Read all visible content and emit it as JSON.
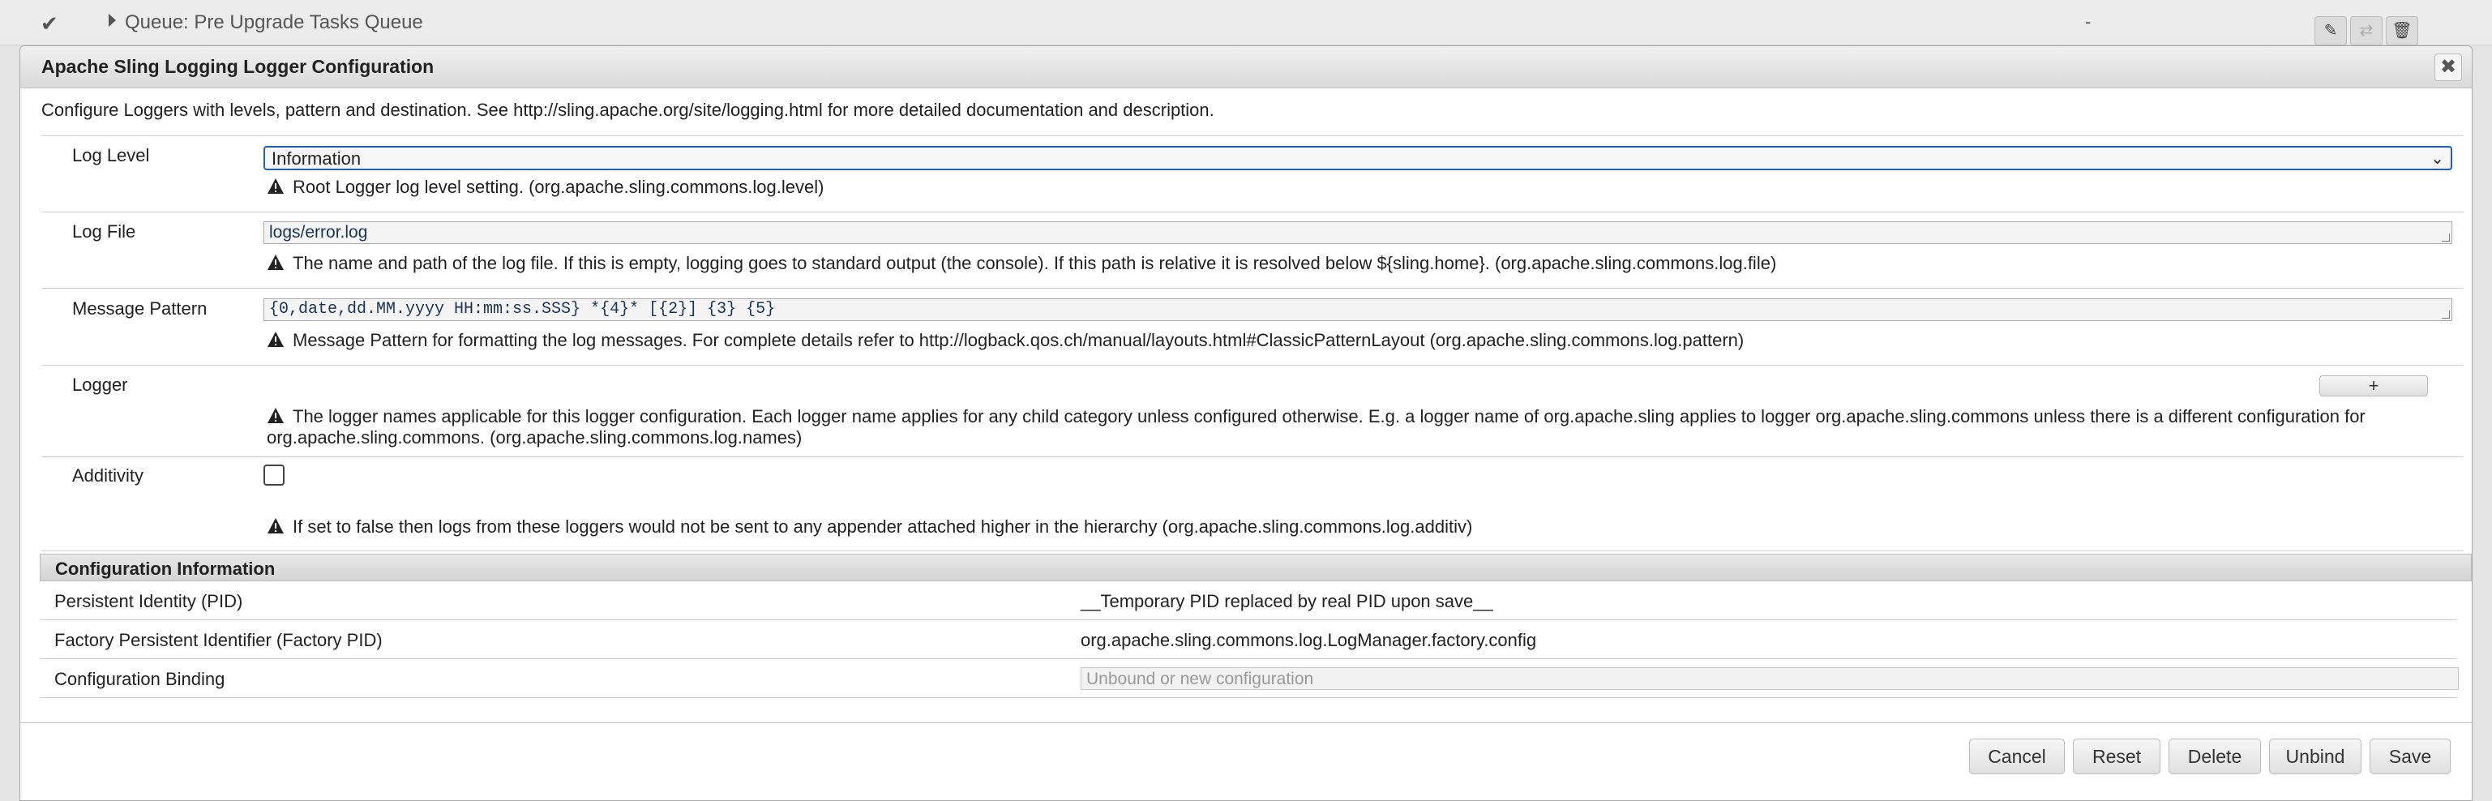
{
  "background": {
    "queue_label": "Queue: Pre Upgrade Tasks Queue",
    "status_dash": "-"
  },
  "dialog": {
    "title": "Apache Sling Logging Logger Configuration",
    "description": "Configure Loggers with levels, pattern and destination. See http://sling.apache.org/site/logging.html for more detailed documentation and description.",
    "fields": {
      "log_level": {
        "label": "Log Level",
        "value": "Information",
        "help": "Root Logger log level setting. (org.apache.sling.commons.log.level)"
      },
      "log_file": {
        "label": "Log File",
        "value": "logs/error.log",
        "help": "The name and path of the log file. If this is empty, logging goes to standard output (the console). If this path is relative it is resolved below ${sling.home}. (org.apache.sling.commons.log.file)"
      },
      "message_pattern": {
        "label": "Message Pattern",
        "value": "{0,date,dd.MM.yyyy HH:mm:ss.SSS} *{4}* [{2}] {3} {5}",
        "help": "Message Pattern for formatting the log messages. For complete details refer to http://logback.qos.ch/manual/layouts.html#ClassicPatternLayout (org.apache.sling.commons.log.pattern)"
      },
      "logger": {
        "label": "Logger",
        "add_label": "+",
        "help": "The logger names applicable for this logger configuration. Each logger name applies for any child category unless configured otherwise. E.g. a logger name of org.apache.sling applies to logger org.apache.sling.commons unless there is a different configuration for org.apache.sling.commons. (org.apache.sling.commons.log.names)"
      },
      "additivity": {
        "label": "Additivity",
        "checked": false,
        "help": "If set to false then logs from these loggers would not be sent to any appender attached higher in the hierarchy (org.apache.sling.commons.log.additiv)"
      }
    },
    "config_info": {
      "heading": "Configuration Information",
      "pid_label": "Persistent Identity (PID)",
      "pid_value": "__Temporary PID replaced by real PID upon save__",
      "factory_pid_label": "Factory Persistent Identifier (Factory PID)",
      "factory_pid_value": "org.apache.sling.commons.log.LogManager.factory.config",
      "binding_label": "Configuration Binding",
      "binding_placeholder": "Unbound or new configuration"
    },
    "buttons": {
      "cancel": "Cancel",
      "reset": "Reset",
      "delete": "Delete",
      "unbind": "Unbind",
      "save": "Save"
    }
  }
}
